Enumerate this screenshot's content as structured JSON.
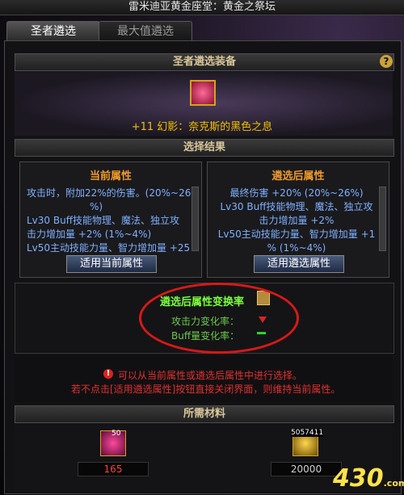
{
  "window": {
    "title": "雷米迪亚黄金座堂：黄金之祭坛"
  },
  "tabs": [
    {
      "label": "圣者遴选"
    },
    {
      "label": "最大值遴选"
    }
  ],
  "equip_section": {
    "header": "圣者遴选装备",
    "help_label": "?",
    "item_name": "+11 幻影：奈克斯的黑色之息"
  },
  "result_section": {
    "header": "选择结果",
    "current": {
      "title": "当前属性",
      "lines": [
        "攻击时，附加22%的伤害。(20%~26",
        "%)",
        "Lv30 Buff技能物理、魔法、独立攻",
        "击力增加量 +2% (1%~4%)",
        "Lv50主动技能力量、智力增加量 +25"
      ],
      "button": "适用当前属性"
    },
    "selected": {
      "title": "遴选后属性",
      "lines": [
        "最终伤害 +20% (20%~26%)",
        "Lv30 Buff技能物理、魔法、独立攻",
        "击力增加量 +2%",
        "Lv50主动技能力量、智力增加量 +1",
        "% (1%~4%)"
      ],
      "button": "适用遴选属性"
    }
  },
  "probability": {
    "title": "遴选后属性变换率",
    "rows": [
      {
        "label": "攻击力变化率："
      },
      {
        "label": "Buff量变化率："
      }
    ]
  },
  "notes": [
    "可以从当前属性或遴选后属性中进行选择。",
    "若不点击[适用遴选属性]按钮直接关闭界面，则维持当前属性。"
  ],
  "materials": {
    "header": "所需材料",
    "items": [
      {
        "badge": "50",
        "count": "165"
      },
      {
        "badge": "5057411",
        "count": "20000"
      }
    ]
  },
  "watermark": {
    "text": "430",
    "suffix": ".com"
  },
  "colors": {
    "highlight": "#d81818",
    "attr_text": "#7fb0ff",
    "good": "#7cff3a",
    "warning": "#e23030"
  }
}
